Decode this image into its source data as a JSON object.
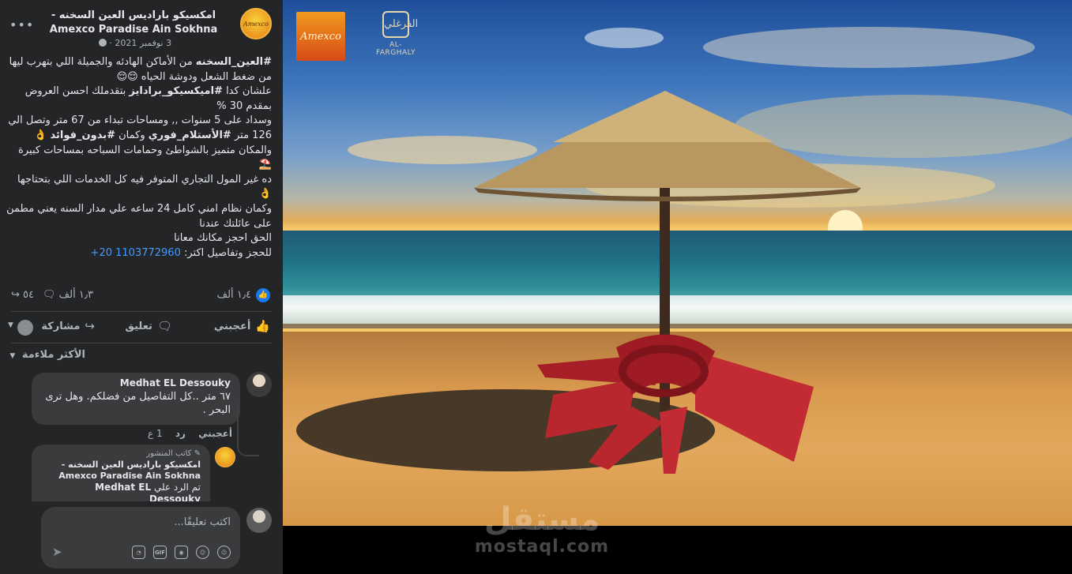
{
  "post": {
    "page_name": "امكسيكو باراديس العين السخنه - Amexco Paradise Ain Sokhna",
    "date": "3 نوفمبر 2021 ·",
    "more_label": "•••",
    "body": {
      "l1_tag": "#العين_السخنه",
      "l1_rest": " من الأماكن الهادئه والجميلة اللي بتهرب ليها من ضغط الشعل ودوشة الحياه 😌😌",
      "l2_pre": "علشان كدا ",
      "l2_tag": "#اميكسيكو_برادايز",
      "l2_rest": " بتقدملك احسن العروض بمقدم 30 %",
      "l3_a": "وسداد على 5 سنوات ,, ومساحات تبداء من 67 متر وتصل الي 126 متر ",
      "l3_tag1": "#الأستلام_فوري",
      "l3_b": " وكمان ",
      "l3_tag2": "#بدون_فوائد",
      "l3_c": " 👌",
      "l4": "والمكان متميز بالشواطئ وحمامات السباحه بمساحات كبيرة ⛱️",
      "l5": "ده غير المول التجاري المتوفر فيه كل الخدمات اللي بتحتاجها 👌",
      "l6": "وكمان نظام امني كامل 24 ساعه علي مدار السنه يعني مطمن على عائلتك عندنا",
      "l7": "الحق احجز مكانك معانا",
      "l8_pre": "للحجز وتفاصيل اكتر: ",
      "phone": "1103772960 20+"
    }
  },
  "stats": {
    "likes": "١٫٤ ألف",
    "comments": "١٫٣ ألف",
    "shares": "٥٤"
  },
  "actions": {
    "like_label": "أعجبني",
    "comment_label": "تعليق",
    "share_label": "مشاركة"
  },
  "sort_label": "الأكثر ملاءمة",
  "comment": {
    "author": "Medhat EL Dessouky",
    "text": "٦٧ متر ..كل التفاصيل من فضلكم. وهل ترى البحر .",
    "like": "أعجبني",
    "reply": "رد",
    "time": "1 ع"
  },
  "reply": {
    "author_tag": "كاتب المنشور",
    "author_name": "امكسيكو باراديس العين السخنه - Amexco Paradise Ain Sokhna",
    "text_pre": "تم الرد علي ",
    "text_name": "Medhat EL Dessouky"
  },
  "composer": {
    "placeholder": "اكتب تعليقًا..."
  },
  "media": {
    "logo_amexco": "Amexco",
    "logo_farghaly_emblem": "الفرغلي",
    "logo_farghaly_text": "AL-FARGHALY",
    "watermark_ar": "مستقل",
    "watermark_en": "mostaql.com"
  },
  "colors": {
    "panel_bg": "#242526",
    "bubble_bg": "#3a3b3c",
    "link": "#4599ff",
    "like_blue": "#1877f2"
  },
  "icons": [
    "more-icon",
    "globe-icon",
    "like-reaction-icon",
    "comment-icon",
    "share-icon",
    "thumb-icon",
    "caret-down-icon",
    "pencil-icon",
    "sticker-icon",
    "gif-icon",
    "camera-icon",
    "emoji-icon",
    "avatar-icon",
    "send-icon"
  ]
}
